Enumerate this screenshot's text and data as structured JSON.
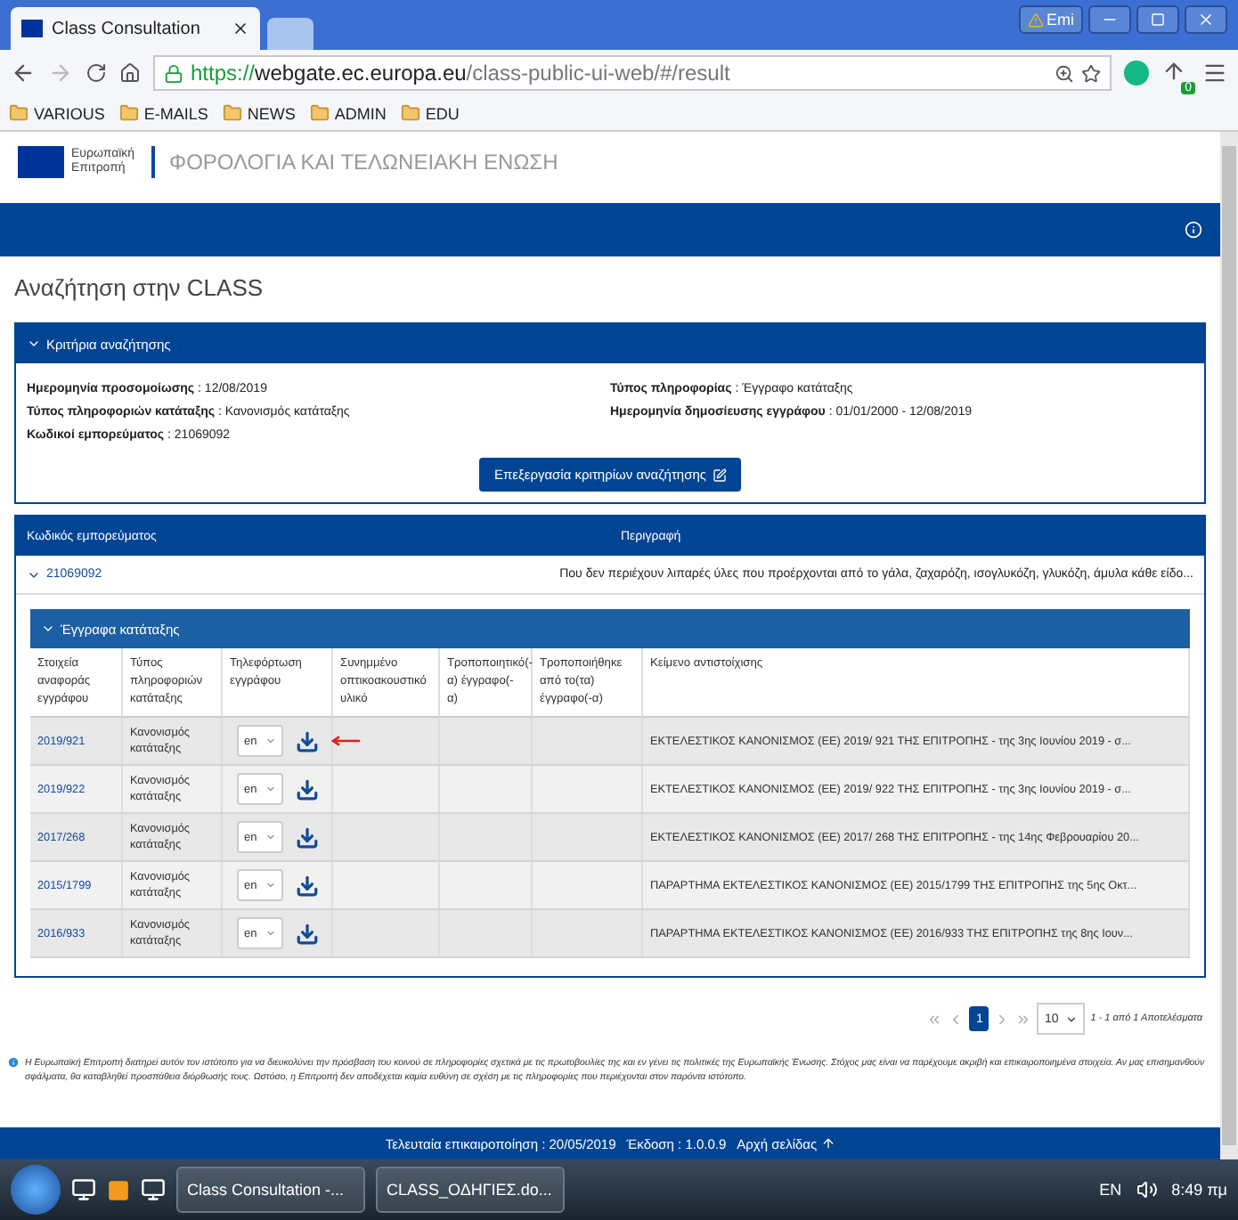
{
  "browser": {
    "tabs": [
      {
        "title": "Class Consultation",
        "selected": true
      },
      {
        "selected": false
      }
    ],
    "profile": "Emi",
    "url": {
      "scheme": "https://",
      "host": "webgate.ec.europa.eu",
      "path": "/class-public-ui-web/#/result"
    },
    "extension_badge": "0",
    "bookmarks": [
      "VARIOUS",
      "E-MAILS",
      "NEWS",
      "ADMIN",
      "EDU"
    ]
  },
  "site_header": {
    "org": "Ευρωπαϊκή Επιτροπή",
    "title": "ΦΟΡΟΛΟΓΙΑ ΚΑΙ ΤΕΛΩΝΕΙΑΚΗ ΕΝΩΣΗ"
  },
  "page_title": "Αναζήτηση στην CLASS",
  "criteria": {
    "header": "Κριτήρια αναζήτησης",
    "expanded": true,
    "separator": ":",
    "left": [
      {
        "label": "Ημερομηνία προσομοίωσης",
        "value": "12/08/2019"
      },
      {
        "label": "Τύπος πληροφοριών κατάταξης",
        "value": "Κανονισμός κατάταξης"
      },
      {
        "label": "Κωδικοί εμπορεύματος",
        "value": "21069092"
      }
    ],
    "right": [
      {
        "label": "Τύπος πληροφορίας",
        "value": "Έγγραφο κατάταξης"
      },
      {
        "label": "Ημερομηνία δημοσίευσης εγγράφου",
        "value": "01/01/2000 - 12/08/2019"
      }
    ],
    "edit_button": "Επεξεργασία κριτηρίων αναζήτησης"
  },
  "goods": {
    "columns": [
      "Κωδικός εμπορεύματος",
      "Περιγραφή"
    ],
    "rows": [
      {
        "code": "21069092",
        "expanded": true,
        "description": "Που δεν περιέχουν λιπαρές ύλες που προέρχονται από το γάλα, ζαχαρόζη, ισογλυκόζη, γλυκόζη, άμυλα κάθε είδο..."
      }
    ]
  },
  "documents": {
    "header": "Έγγραφα κατάταξης",
    "expanded": true,
    "columns": [
      "Στοιχεία αναφοράς εγγράφου",
      "Τύπος πληροφοριών κατάταξης",
      "Τηλεφόρτωση εγγράφου",
      "Συνημμένο οπτικοακουστικό υλικό",
      "Τροποποιητικό(-α) έγγραφο(-α)",
      "Τροποποιήθηκε από το(τα) έγγραφο(-α)",
      "Κείμενο αντιστοίχισης"
    ],
    "rows": [
      {
        "reference": "2019/921",
        "type": "Κανονισμός κατάταξης",
        "language": "en",
        "annotated": true,
        "text": "ΕΚΤΕΛΕΣΤΙΚΟΣ ΚΑΝΟΝΙΣΜΟΣ (ΕΕ) 2019/ 921 ΤΗΣ ΕΠΙΤΡΟΠΗΣ - της 3ης Ιουνίου 2019 - σ..."
      },
      {
        "reference": "2019/922",
        "type": "Κανονισμός κατάταξης",
        "language": "en",
        "annotated": false,
        "text": "ΕΚΤΕΛΕΣΤΙΚΟΣ ΚΑΝΟΝΙΣΜΟΣ (ΕΕ) 2019/ 922 ΤΗΣ ΕΠΙΤΡΟΠΗΣ - της 3ης Ιουνίου 2019 - σ..."
      },
      {
        "reference": "2017/268",
        "type": "Κανονισμός κατάταξης",
        "language": "en",
        "annotated": false,
        "text": "ΕΚΤΕΛΕΣΤΙΚΟΣ ΚΑΝΟΝΙΣΜΟΣ (ΕΕ) 2017/ 268 ΤΗΣ ΕΠΙΤΡΟΠΗΣ - της 14ης Φεβρουαρίου 20..."
      },
      {
        "reference": "2015/1799",
        "type": "Κανονισμός κατάταξης",
        "language": "en",
        "annotated": false,
        "text": "ΠΑΡΑΡΤΗΜΑ ΕΚΤΕΛΕΣΤΙΚΟΣ ΚΑΝΟΝΙΣΜΟΣ (ΕΕ) 2015/1799 ΤΗΣ ΕΠΙΤΡΟΠΗΣ της 5ης Οκτ..."
      },
      {
        "reference": "2016/933",
        "type": "Κανονισμός κατάταξης",
        "language": "en",
        "annotated": false,
        "text": "ΠΑΡΑΡΤΗΜΑ ΕΚΤΕΛΕΣΤΙΚΟΣ ΚΑΝΟΝΙΣΜΟΣ (ΕΕ) 2016/933 ΤΗΣ ΕΠΙΤΡΟΠΗΣ της 8ης Ιουν..."
      }
    ]
  },
  "pagination": {
    "pages": [
      {
        "label": "1",
        "selected": true
      }
    ],
    "page_size": "10",
    "summary": "1 - 1 από 1 Αποτελέσματα"
  },
  "disclaimer": "Η Ευρωπαϊκή Επιτροπή διατηρεί αυτόν τον ιστότοπο για να διευκολύνει την πρόσβαση του κοινού σε πληροφορίες σχετικά με τις πρωτοβουλίες της και εν γένει τις πολιτικές της Ευρωπαϊκής Ένωσης. Στόχος μας είναι να παρέχουμε ακριβή και επικαιροποιημένα στοιχεία. Αν μας επισημανθούν σφάλματα, θα καταβληθεί προσπάθεια διόρθωσής τους. Ωστόσο, η Επιτροπή δεν αποδέχεται καμία ευθύνη σε σχέση με τις πληροφορίες που περιέχονται στον παρόντα ιστότοπο.",
  "footer": {
    "last_update": "Τελευταία επικαιροποίηση : 20/05/2019",
    "version": "Έκδοση : 1.0.0.9",
    "top_link": "Αρχή σελίδας"
  },
  "taskbar": {
    "windows": [
      "Class Consultation -...",
      "CLASS_ΟΔΗΓΙΕΣ.do..."
    ],
    "language": "EN",
    "time": "8:49 πμ"
  }
}
